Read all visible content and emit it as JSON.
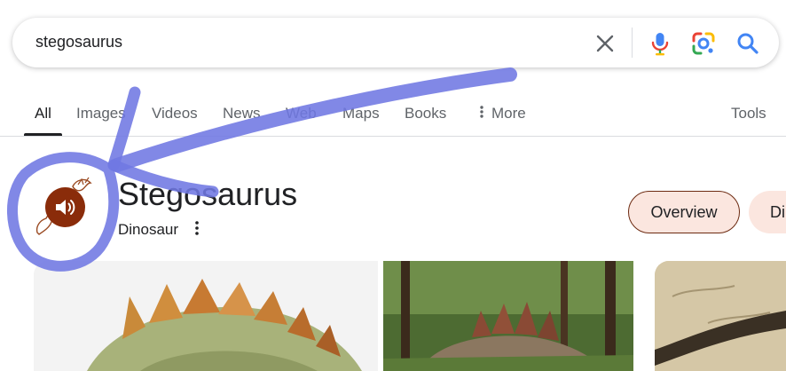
{
  "search": {
    "query": "stegosaurus",
    "clear_icon": "close-icon",
    "mic_icon": "microphone-icon",
    "lens_icon": "google-lens-icon",
    "search_icon": "search-icon"
  },
  "tabs": [
    {
      "label": "All",
      "active": true
    },
    {
      "label": "Images"
    },
    {
      "label": "Videos"
    },
    {
      "label": "News"
    },
    {
      "label": "Web"
    },
    {
      "label": "Maps"
    },
    {
      "label": "Books"
    },
    {
      "label": "More",
      "icon": "more-vertical-icon"
    }
  ],
  "tools_label": "Tools",
  "knowledge_panel": {
    "title": "Stegosaurus",
    "subtitle": "Dinosaur",
    "audio_icon": "speaker-icon",
    "chips": [
      "Overview",
      "Di"
    ]
  },
  "images": [
    "stegosaurus-model",
    "stegosaurus-forest",
    "stegosaurus-fossil"
  ],
  "colors": {
    "accent_brown": "#8a2c0a",
    "chip_bg": "#fbe6df",
    "annotation_blue": "#6f78e2",
    "link_blue": "#4285f4"
  }
}
